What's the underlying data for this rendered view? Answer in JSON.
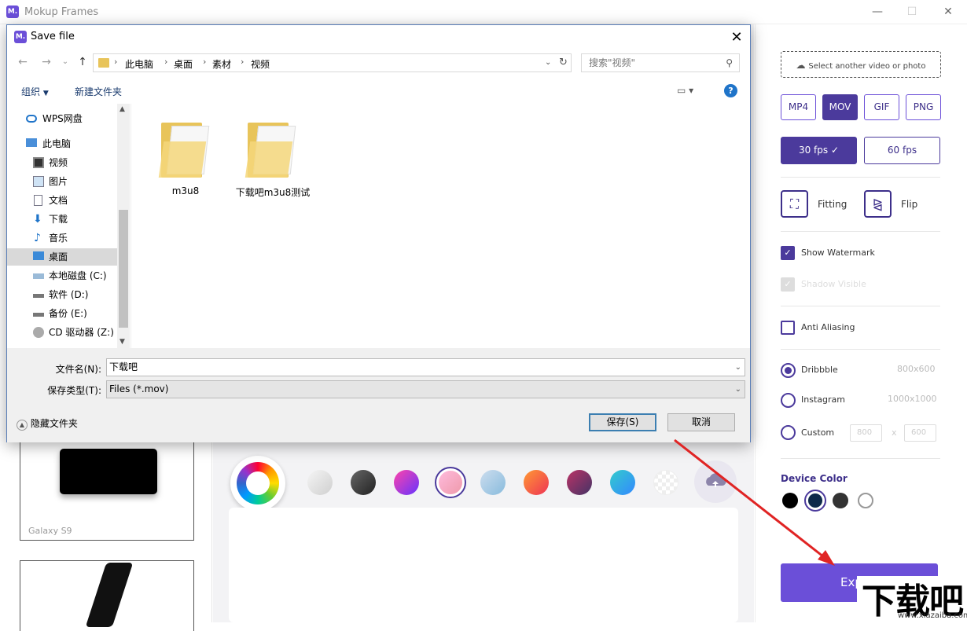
{
  "app": {
    "title": "Mokup Frames",
    "logo": "M."
  },
  "left_panel": {
    "devices": [
      {
        "label": "Galaxy S9"
      },
      {
        "label": ""
      }
    ]
  },
  "right_panel": {
    "upload_label": "Select another video or photo",
    "formats": [
      "MP4",
      "MOV",
      "GIF",
      "PNG"
    ],
    "active_format": "MOV",
    "fps": [
      "30 fps",
      "60 fps"
    ],
    "active_fps": "30 fps",
    "fitting_label": "Fitting",
    "flip_label": "Flip",
    "show_watermark": "Show Watermark",
    "shadow_visible": "Shadow Visible",
    "anti_aliasing": "Anti Aliasing",
    "sizes": [
      {
        "label": "Dribbble",
        "dims": "800x600"
      },
      {
        "label": "Instagram",
        "dims": "1000x1000"
      },
      {
        "label": "Custom",
        "dims": ""
      }
    ],
    "custom_w": "800",
    "custom_sep": "x",
    "custom_h": "600",
    "device_color_label": "Device Color",
    "export_label": "Exp"
  },
  "dialog": {
    "title": "Save file",
    "breadcrumb": [
      "此电脑",
      "桌面",
      "素材",
      "视频"
    ],
    "search_placeholder": "搜索\"视频\"",
    "organize": "组织",
    "new_folder": "新建文件夹",
    "nav": [
      "WPS网盘",
      "此电脑",
      "视频",
      "图片",
      "文档",
      "下载",
      "音乐",
      "桌面",
      "本地磁盘 (C:)",
      "软件 (D:)",
      "备份 (E:)",
      "CD 驱动器 (Z:)"
    ],
    "selected_nav": "桌面",
    "files": [
      "m3u8",
      "下载吧m3u8测试"
    ],
    "filename_label": "文件名(N):",
    "filename_value": "下载吧",
    "filetype_label": "保存类型(T):",
    "filetype_value": "Files (*.mov)",
    "hide_folders": "隐藏文件夹",
    "save": "保存(S)",
    "cancel": "取消"
  },
  "watermark": {
    "text": "下载吧",
    "url": "www.xiazaiba.com"
  },
  "colors": {
    "accent": "#6b4fd8",
    "accent_dark": "#4b3a9c"
  }
}
